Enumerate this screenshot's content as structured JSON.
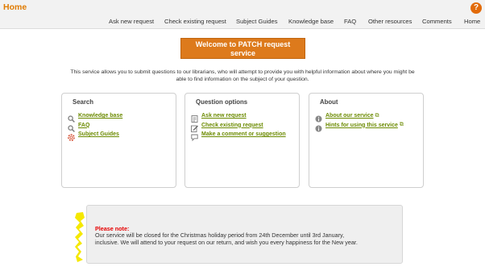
{
  "header": {
    "home_label": "Home",
    "help_label": "?",
    "nav": [
      "Ask new request",
      "Check existing request",
      "Subject Guides",
      "Knowledge base",
      "FAQ",
      "Other resources",
      "Comments",
      "Home"
    ]
  },
  "welcome": {
    "line1": "Welcome to PATCH request",
    "line2": "service"
  },
  "intro": {
    "line1": "This service allows you to submit questions to our librarians, who will attempt to provide you with helpful information about where you might be",
    "line2": "able to find information on the subject of your question."
  },
  "panels": {
    "search": {
      "title": "Search",
      "items": [
        {
          "label": "Knowledge base",
          "icon": "magnifier-icon"
        },
        {
          "label": "FAQ",
          "icon": "magnifier-icon"
        },
        {
          "label": "Subject Guides",
          "icon": "lifebuoy-icon"
        }
      ]
    },
    "options": {
      "title": "Question options",
      "items": [
        {
          "label": "Ask new request",
          "icon": "form-icon"
        },
        {
          "label": "Check existing request",
          "icon": "edit-icon"
        },
        {
          "label": "Make a comment or suggestion",
          "icon": "speech-bubble-icon"
        }
      ]
    },
    "about": {
      "title": "About",
      "items": [
        {
          "label": "About our service",
          "icon": "info-icon"
        },
        {
          "label": "Hints for using this service",
          "icon": "info-icon"
        }
      ]
    }
  },
  "notice": {
    "title": "Please note:",
    "line1": "Our service will be closed for the Christmas holiday period from 24th December until 3rd January,",
    "line2": "inclusive.  We will attend to your request on our return, and wish you every happiness for the New year."
  },
  "colors": {
    "accent": "#e07b00",
    "button": "#dd7a1c",
    "link": "#6b8a00",
    "notice_title": "#e60000",
    "highlight": "#f5e800"
  }
}
